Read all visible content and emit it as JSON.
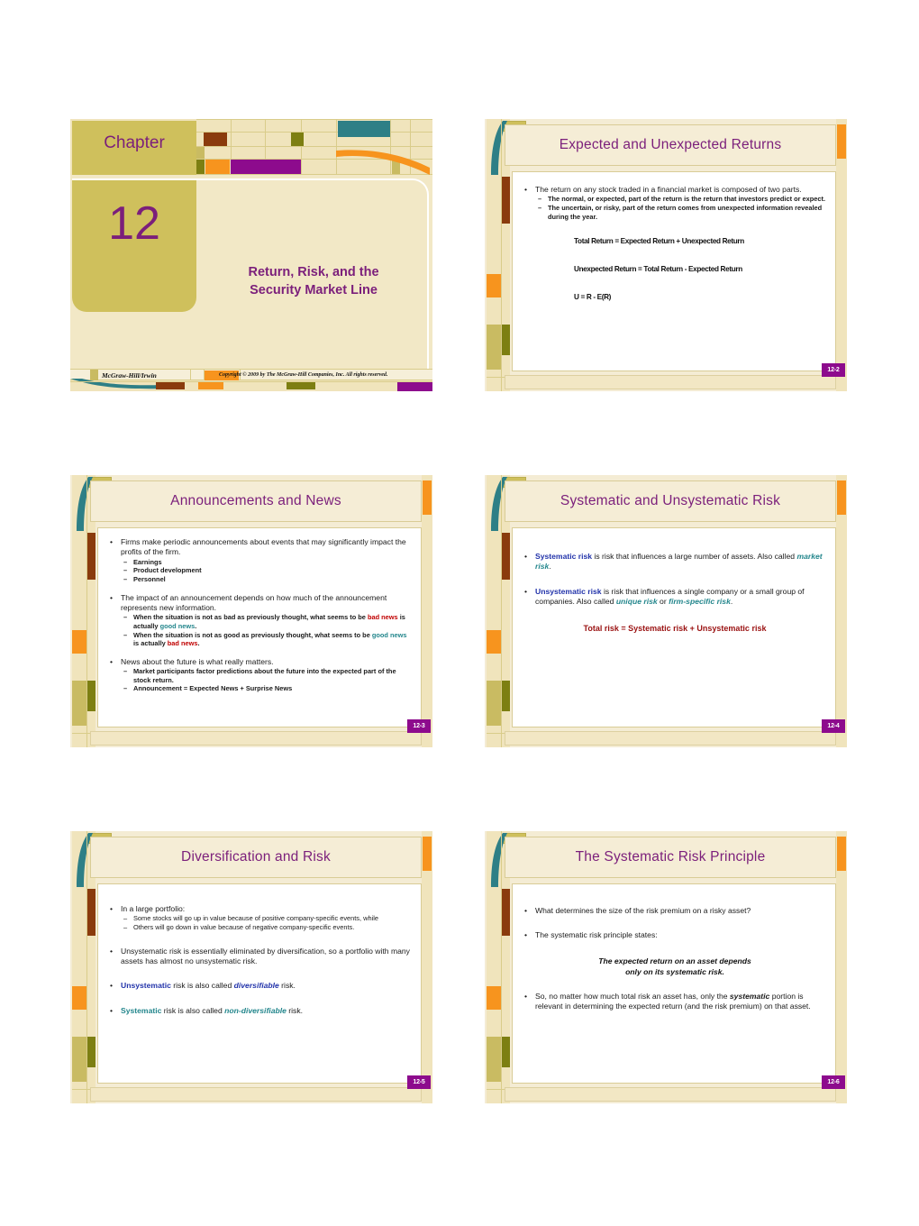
{
  "document": {
    "kind": "lecture-slide-handout",
    "slide_count": 6
  },
  "title_slide": {
    "chapter_label": "Chapter",
    "chapter_number": "12",
    "subtitle_line1": "Return, Risk, and the",
    "subtitle_line2": "Security Market Line",
    "footer_brand": "McGraw-Hill/Irwin",
    "footer_copyright": "Copyright © 2009 by The McGraw-Hill Companies, Inc. All rights reserved.",
    "colors": {
      "accent_purple": "#7b1f7b",
      "khaki": "#cfc05c",
      "cream": "#f0e4bc",
      "orange": "#f7941e",
      "teal": "#2e7f86",
      "brown": "#8a3b0d",
      "olive": "#7d7f12"
    }
  },
  "slides": [
    {
      "number": "12-2",
      "title": "Expected and Unexpected Returns",
      "bullets": [
        {
          "level": 1,
          "text": "The return on any stock traded in a financial market is composed of two parts."
        },
        {
          "level": 2,
          "text": "The normal, or expected, part of the return is the return that investors predict or expect."
        },
        {
          "level": 2,
          "text": "The uncertain, or risky, part of the return comes from unexpected information revealed during the year."
        }
      ],
      "equations": [
        "Total Return = Expected Return + Unexpected Return",
        "Unexpected Return = Total Return - Expected Return",
        "U = R - E(R)"
      ]
    },
    {
      "number": "12-3",
      "title": "Announcements and News",
      "bullets": [
        {
          "level": 1,
          "text": "Firms make periodic announcements about events that may significantly impact the profits of the firm."
        },
        {
          "level": 2,
          "text": "Earnings"
        },
        {
          "level": 2,
          "text": "Product development"
        },
        {
          "level": 2,
          "text": "Personnel"
        },
        {
          "level": 1,
          "text": "The impact of an announcement depends on how much of the announcement represents new information."
        },
        {
          "level": 2,
          "text": "When the situation is not as bad as previously thought, what seems to be bad news is actually good news."
        },
        {
          "level": 2,
          "text": "When the situation is not as good as previously thought, what seems to be good news is actually bad news."
        },
        {
          "level": 1,
          "text": "News about the future is what really matters."
        },
        {
          "level": 2,
          "text": "Market participants factor predictions about the future into the expected part of the stock return."
        },
        {
          "level": 2,
          "text": "Announcement = Expected News + Surprise News"
        }
      ],
      "inline_terms": {
        "bad_news": "bad news",
        "good_news": "good news"
      }
    },
    {
      "number": "12-4",
      "title": "Systematic and Unsystematic Risk",
      "bullets": [
        {
          "level": 1,
          "term": "Systematic risk",
          "text": " is risk that influences a large number of assets.  Also called ",
          "emph": "market risk",
          "tail": "."
        },
        {
          "level": 1,
          "term": "Unsystematic risk",
          "text": " is risk that influences a single company or a small group of companies. Also called ",
          "emph": "unique risk",
          "mid": " or ",
          "emph2": "firm-specific risk",
          "tail": "."
        }
      ],
      "callout": "Total risk = Systematic risk + Unsystematic risk"
    },
    {
      "number": "12-5",
      "title": "Diversification and Risk",
      "bullets": [
        {
          "level": 1,
          "text": "In a large portfolio:"
        },
        {
          "level": 2,
          "text": "Some stocks will go up in value because of positive company-specific events, while"
        },
        {
          "level": 2,
          "text": "Others will go down in value because of negative company-specific events."
        },
        {
          "level": 1,
          "text": "Unsystematic risk is essentially eliminated by diversification, so a portfolio with many assets has almost no unsystematic risk."
        },
        {
          "level": 1,
          "term": "Unsystematic",
          "text": " risk is also called ",
          "emph": "diversifiable",
          "tail": " risk."
        },
        {
          "level": 1,
          "term2": "Systematic",
          "text2": " risk is also called ",
          "emph3": "non-diversifiable",
          "tail2": " risk."
        }
      ]
    },
    {
      "number": "12-6",
      "title": "The Systematic Risk Principle",
      "bullets": [
        {
          "level": 1,
          "text": "What determines the size of the risk premium on a risky asset?"
        },
        {
          "level": 1,
          "text": "The systematic risk principle states:"
        },
        {
          "level": 1,
          "text": "So, no matter how much total risk an asset has, only the systematic portion is relevant in determining the expected return (and the risk premium) on that asset."
        }
      ],
      "callout_line1": "The expected return on an asset depends",
      "callout_line2": "only on its systematic risk.",
      "emph_word": "systematic"
    }
  ]
}
